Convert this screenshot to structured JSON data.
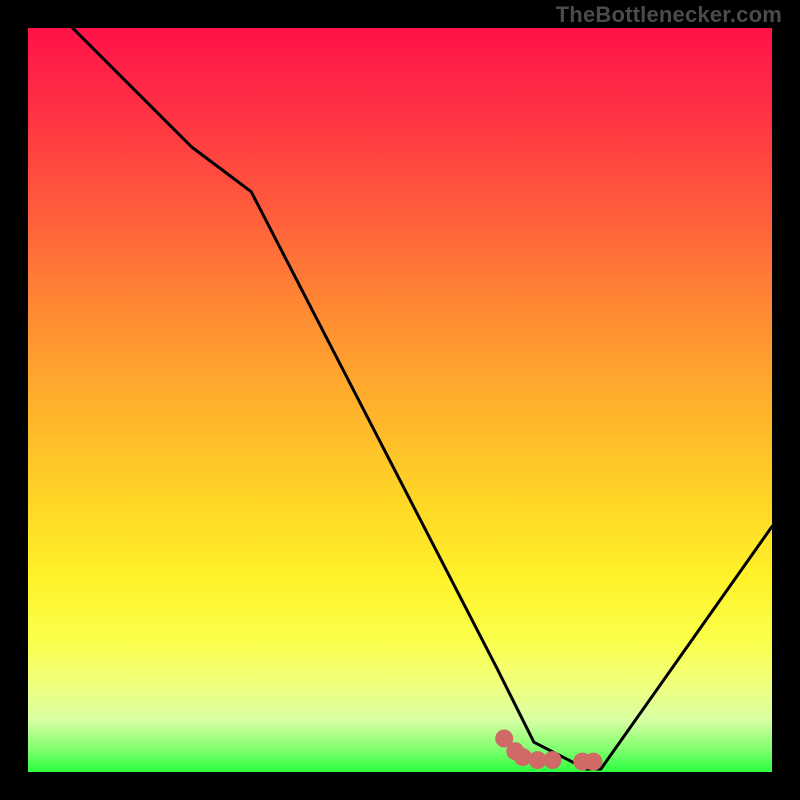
{
  "attribution": "TheBottlenecker.com",
  "chart_data": {
    "type": "line",
    "title": "",
    "xlabel": "",
    "ylabel": "",
    "xlim": [
      0,
      100
    ],
    "ylim": [
      0,
      100
    ],
    "series": [
      {
        "name": "bottleneck-curve",
        "x": [
          6,
          22,
          30,
          63,
          68,
          75,
          77,
          100
        ],
        "y": [
          100,
          84,
          78,
          14,
          4,
          0.4,
          0.4,
          33
        ]
      }
    ],
    "markers": {
      "name": "bottom-dots",
      "points": [
        {
          "x": 64,
          "y": 4.5
        },
        {
          "x": 65.5,
          "y": 2.8
        },
        {
          "x": 66.5,
          "y": 2.0
        },
        {
          "x": 68.5,
          "y": 1.6
        },
        {
          "x": 70.5,
          "y": 1.6
        },
        {
          "x": 74.5,
          "y": 1.4
        },
        {
          "x": 76.0,
          "y": 1.4
        }
      ],
      "color": "#cf6a66",
      "radius_px": 9
    },
    "gradient_stops": [
      {
        "pos": 0.0,
        "color": "#ff1248"
      },
      {
        "pos": 0.5,
        "color": "#ffc029"
      },
      {
        "pos": 0.82,
        "color": "#f8ff55"
      },
      {
        "pos": 1.0,
        "color": "#2bff3f"
      }
    ]
  }
}
